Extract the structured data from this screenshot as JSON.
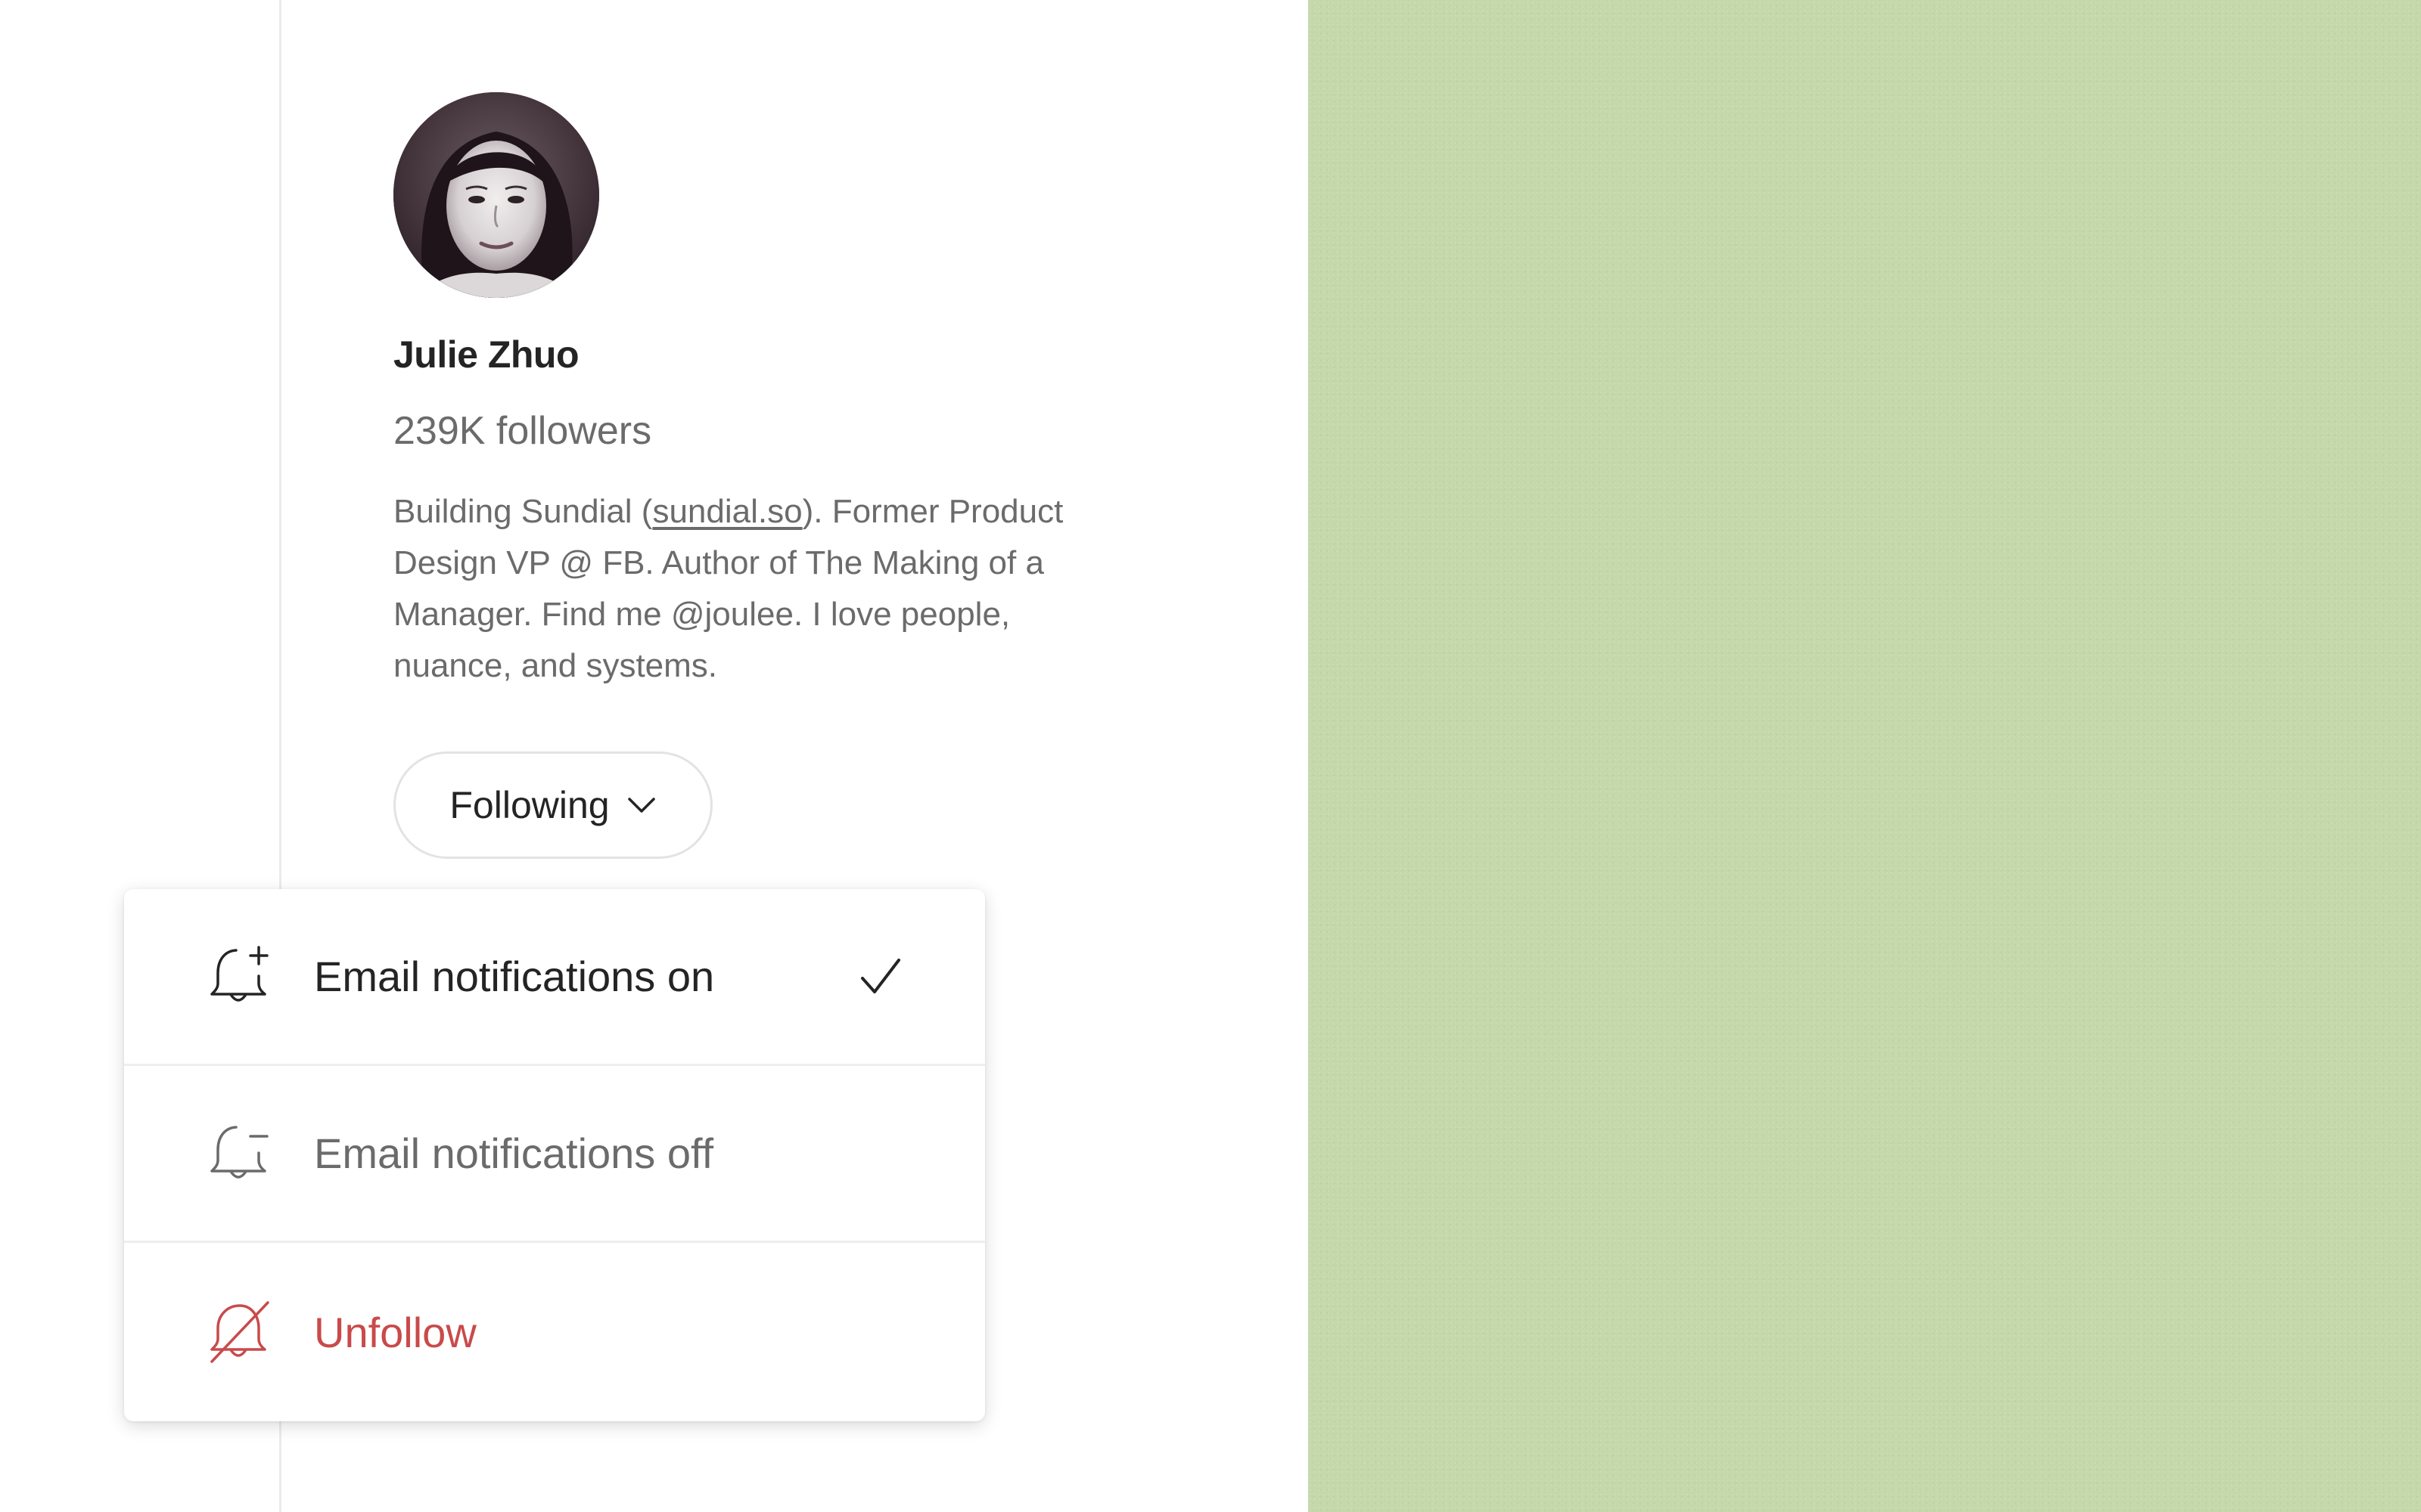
{
  "profile": {
    "name": "Julie Zhuo",
    "followers": "239K followers",
    "bio_before_link": "Building Sundial (",
    "bio_link": "sundial.so",
    "bio_after_link": "). Former Product Design VP @ FB. Author of The Making of a Manager. Find me @joulee. I love people, nuance, and systems."
  },
  "follow_button": {
    "label": "Following",
    "icon": "chevron-down-icon"
  },
  "menu": {
    "items": [
      {
        "label": "Email notifications on",
        "icon": "bell-plus-icon",
        "selected": true
      },
      {
        "label": "Email notifications off",
        "icon": "bell-minus-icon",
        "selected": false
      },
      {
        "label": "Unfollow",
        "icon": "bell-off-icon",
        "selected": false
      }
    ]
  },
  "colors": {
    "text_primary": "#242424",
    "text_secondary": "#6b6b6b",
    "danger": "#c94a4a",
    "background_green": "#c5d8ac"
  }
}
